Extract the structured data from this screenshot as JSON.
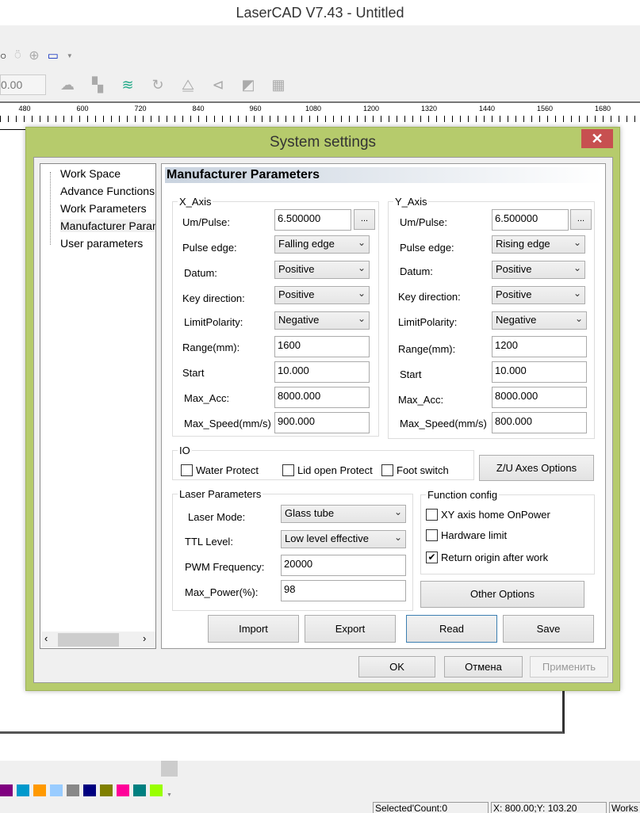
{
  "app": {
    "title": "LaserCAD V7.43 - Untitled"
  },
  "toolbar": {
    "coord_value": "0.00",
    "icons": [
      "circle-icon",
      "pen-icon",
      "target-icon",
      "monitor-wave-icon",
      "cloud-icon",
      "array-icon",
      "layers-icon",
      "rotate-icon",
      "mirror-icon",
      "align-icon",
      "flip-icon",
      "pattern-icon"
    ]
  },
  "ruler": {
    "labels": [
      "480",
      "600",
      "720",
      "840",
      "960",
      "1080",
      "1200",
      "1320",
      "1440",
      "1560",
      "1680"
    ]
  },
  "palette": {
    "colors": [
      "#800080",
      "#0099cc",
      "#ff9900",
      "#99ccff",
      "#888888",
      "#000080",
      "#808000",
      "#ff0099",
      "#008080",
      "#99ff00"
    ]
  },
  "status": {
    "selected": "Selected'Count:0",
    "coords": "X: 800.00;Y: 103.20",
    "workspace": "Works"
  },
  "dialog": {
    "title": "System settings",
    "tree": [
      "Work Space",
      "Advance Functions",
      "Work Parameters",
      "Manufacturer Parameters",
      "User parameters"
    ],
    "header": "Manufacturer Parameters",
    "x_axis": {
      "title": "X_Axis",
      "um_pulse_label": "Um/Pulse:",
      "um_pulse": "6.500000",
      "pulse_edge_label": "Pulse edge:",
      "pulse_edge": "Falling edge",
      "datum_label": "Datum:",
      "datum": "Positive",
      "key_dir_label": "Key direction:",
      "key_dir": "Positive",
      "limit_label": "LimitPolarity:",
      "limit": "Negative",
      "range_label": "Range(mm):",
      "range": "1600",
      "start_label": "Start",
      "start": "10.000",
      "acc_label": "Max_Acc:",
      "acc": "8000.000",
      "speed_label": "Max_Speed(mm/s)",
      "speed": "900.000"
    },
    "y_axis": {
      "title": "Y_Axis",
      "um_pulse_label": "Um/Pulse:",
      "um_pulse": "6.500000",
      "pulse_edge_label": "Pulse edge:",
      "pulse_edge": "Rising edge",
      "datum_label": "Datum:",
      "datum": "Positive",
      "key_dir_label": "Key direction:",
      "key_dir": "Positive",
      "limit_label": "LimitPolarity:",
      "limit": "Negative",
      "range_label": "Range(mm):",
      "range": "1200",
      "start_label": "Start",
      "start": "10.000",
      "acc_label": "Max_Acc:",
      "acc": "8000.000",
      "speed_label": "Max_Speed(mm/s)",
      "speed": "800.000"
    },
    "dots": "...",
    "io": {
      "title": "IO",
      "water": "Water Protect",
      "lid": "Lid open Protect",
      "foot": "Foot switch"
    },
    "zu_button": "Z/U Axes Options",
    "laser": {
      "title": "Laser Parameters",
      "mode_label": "Laser Mode:",
      "mode": "Glass tube",
      "ttl_label": "TTL Level:",
      "ttl": "Low level effective",
      "pwm_label": "PWM Frequency:",
      "pwm": "20000",
      "power_label": "Max_Power(%):",
      "power": "98"
    },
    "func": {
      "title": "Function config",
      "xy_home": "XY axis home OnPower",
      "hw_limit": "Hardware limit",
      "return_origin": "Return origin after work",
      "return_origin_checked": true
    },
    "other_button": "Other Options",
    "import": "Import",
    "export": "Export",
    "read": "Read",
    "save": "Save",
    "ok": "OK",
    "cancel": "Отмена",
    "apply": "Применить"
  }
}
